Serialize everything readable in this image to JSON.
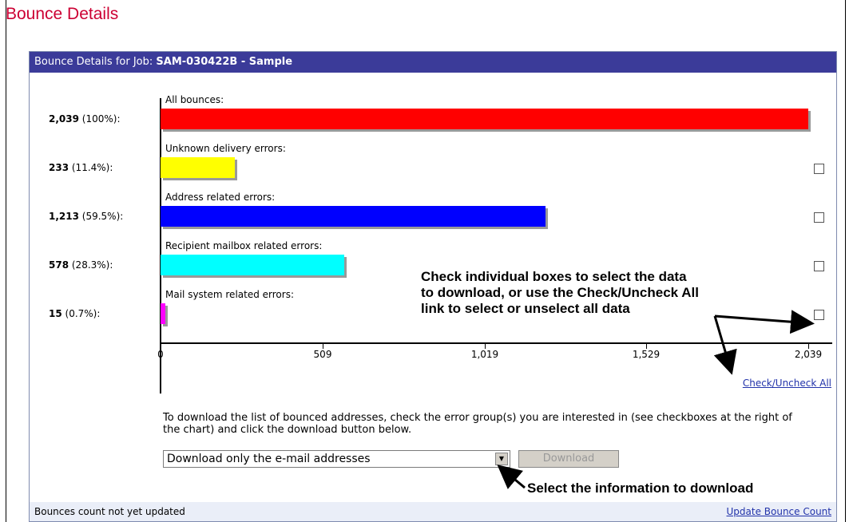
{
  "page_title": "Bounce Details",
  "header": {
    "prefix": "Bounce Details for Job:",
    "job": "SAM-030422B - Sample"
  },
  "chart_data": {
    "type": "bar",
    "orientation": "horizontal",
    "categories": [
      "All bounces:",
      "Unknown delivery errors:",
      "Address related errors:",
      "Recipient mailbox related errors:",
      "Mail system related errors:"
    ],
    "values": [
      2039,
      233,
      1213,
      578,
      15
    ],
    "counts": [
      "2,039",
      "233",
      "1,213",
      "578",
      "15"
    ],
    "percents": [
      "(100%):",
      "(11.4%):",
      "(59.5%):",
      "(28.3%):",
      "(0.7%):"
    ],
    "colors": [
      "#ff0000",
      "#ffff00",
      "#0000ff",
      "#00ffff",
      "#ff00ff"
    ],
    "xticks": [
      "0",
      "509",
      "1,019",
      "1,529",
      "2,039"
    ],
    "xlim": [
      0,
      2039
    ]
  },
  "check_all_label": "Check/Uncheck All",
  "instructions": "To download the list of bounced addresses, check the error group(s) you are interested in (see checkboxes at the right of the chart) and click the download button below.",
  "download_select": {
    "value": "Download only the e-mail addresses"
  },
  "download_button": "Download",
  "footer": {
    "status": "Bounces count not yet updated",
    "update_link": "Update Bounce Count"
  },
  "callouts": {
    "checkbox_help_line1": "Check individual boxes to select the data",
    "checkbox_help_line2": "to download, or use the Check/Uncheck All",
    "checkbox_help_line3": "link to select or unselect all data",
    "select_help": "Select the information to download"
  }
}
